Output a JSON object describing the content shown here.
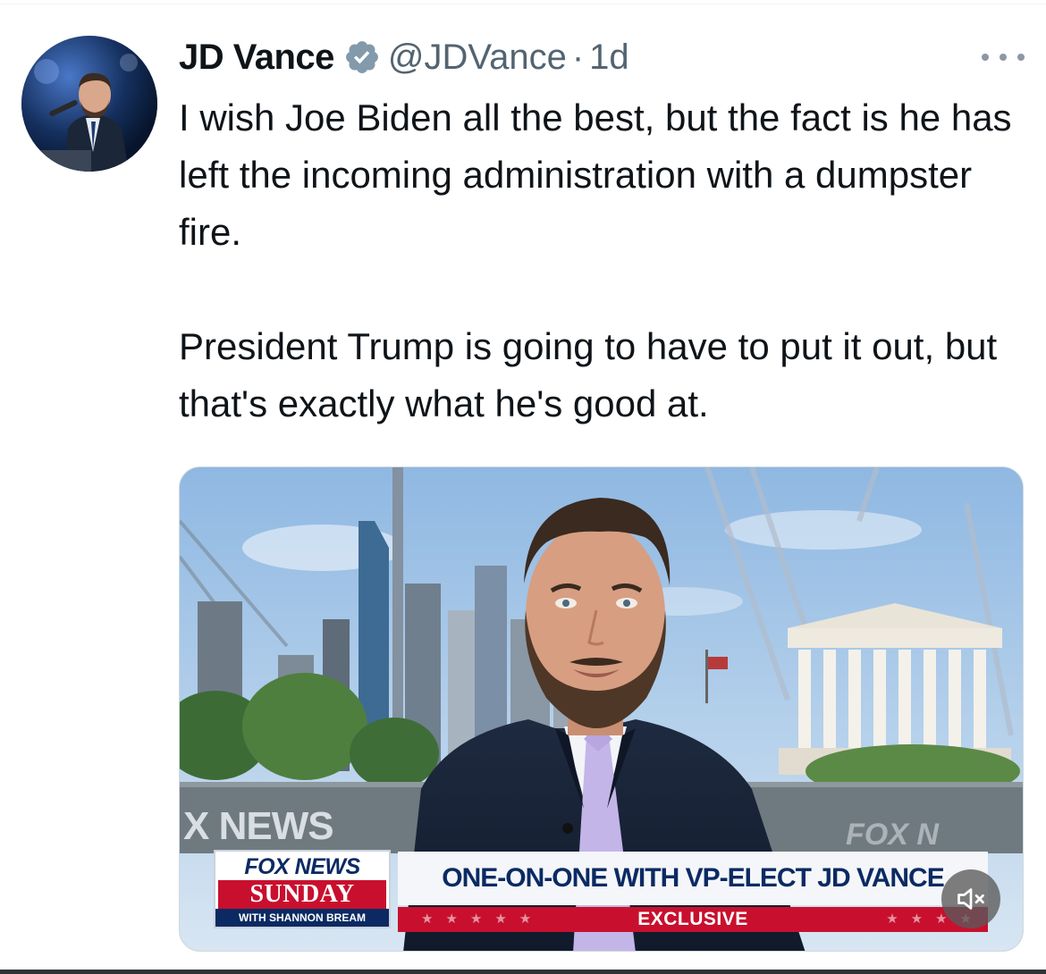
{
  "tweet": {
    "author": {
      "name": "JD Vance",
      "handle": "@JDVance",
      "separator": "·",
      "time": "1d",
      "verified": true
    },
    "text_paragraphs": [
      "I wish Joe Biden all the best, but the fact is he has left the incoming administration with a dumpster fire.",
      "President Trump is going to have to put it out, but that's exactly what he's good at."
    ],
    "media": {
      "background_left_text": "X NEWS",
      "background_right_text": "FOX N",
      "logo_top": "FOX NEWS",
      "logo_main": "SUNDAY",
      "logo_host": "WITH SHANNON BREAM",
      "headline": "ONE-ON-ONE WITH VP-ELECT JD VANCE",
      "bar_label": "EXCLUSIVE",
      "mute_icon": "speaker-muted-icon"
    }
  },
  "colors": {
    "text_primary": "#0f1419",
    "text_secondary": "#536471",
    "verified_blue": "#829aab",
    "fox_red": "#c8102e",
    "fox_navy": "#0b2a63"
  }
}
